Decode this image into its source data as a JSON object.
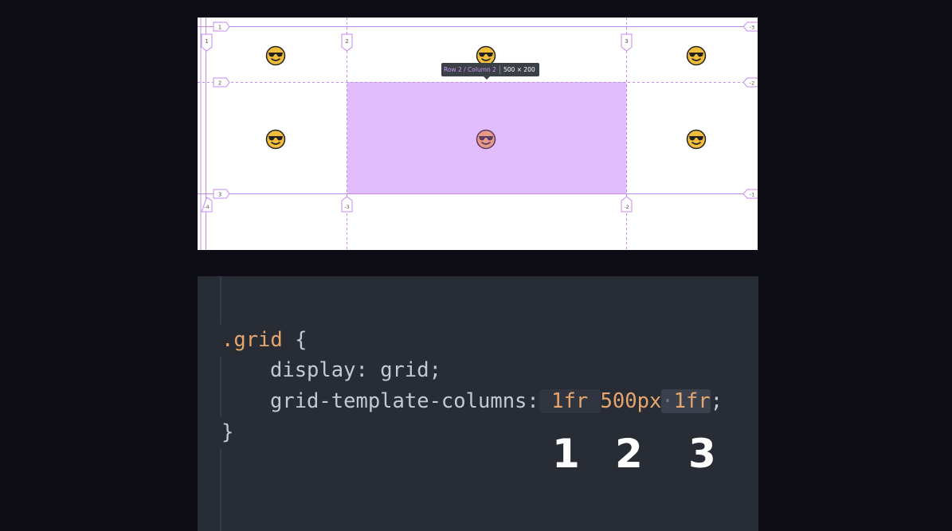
{
  "preview": {
    "line_labels": {
      "top_row_left": "1",
      "left_col_top": "1",
      "col2_top": "2",
      "col3_top": "3",
      "right_col_top": "-3",
      "row2_left": "2",
      "row2_right": "-2",
      "row3_left": "3",
      "row3_right": "-1",
      "bottom_col1": "-4",
      "bottom_col2": "-3",
      "bottom_col3": "-2"
    },
    "tooltip": {
      "area_name": "Row 2 / Column 2",
      "size": "500 × 200"
    },
    "colors": {
      "highlight": "#e2bdfd",
      "grid_line": "#c58af0",
      "emoji": "#f2bd3a",
      "emoji_highlight": "#e89a86"
    }
  },
  "editor": {
    "selector": ".grid",
    "open_brace": "{",
    "prop1": "display",
    "val1": "grid",
    "prop2": "grid-template-columns",
    "val2_a": "1fr",
    "val2_b": "500px",
    "val2_c": "1fr",
    "close_brace": "}",
    "track_numbers": [
      "1",
      "2",
      "3"
    ]
  }
}
